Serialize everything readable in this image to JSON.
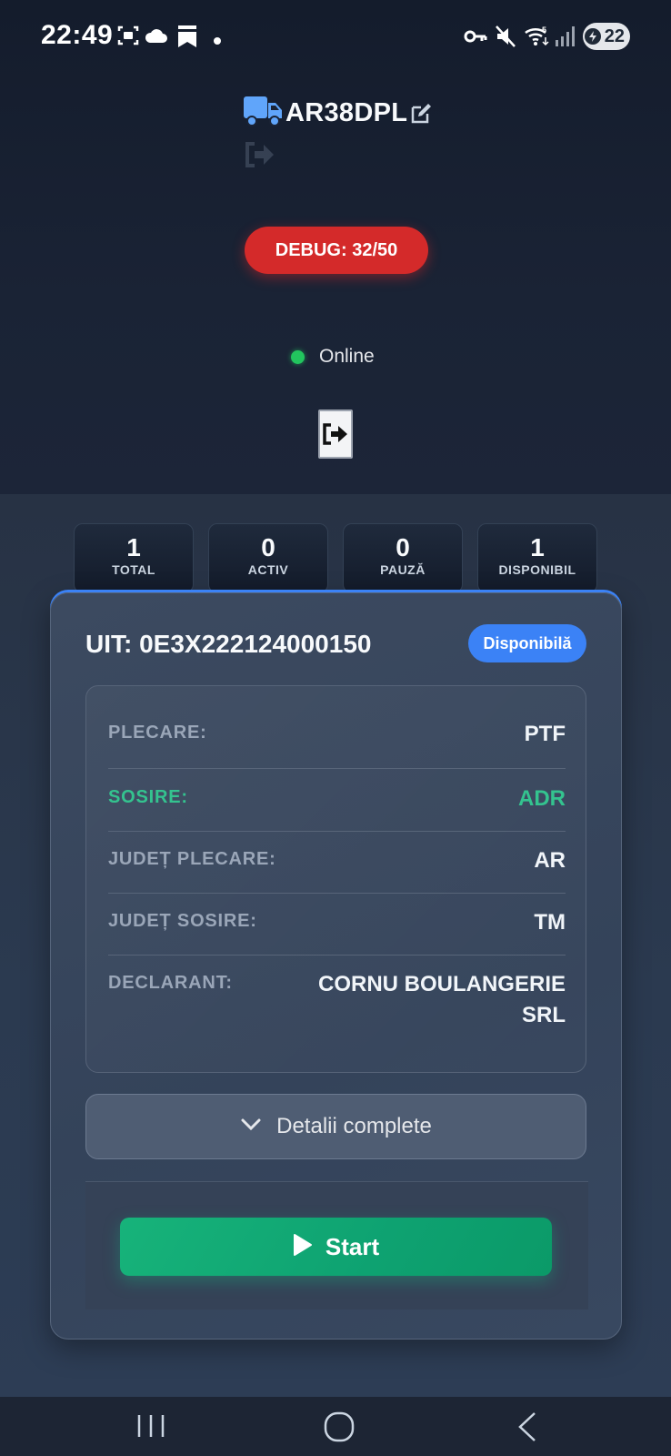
{
  "status_bar": {
    "time": "22:49",
    "battery_level": "22",
    "icons": [
      "screenshot-icon",
      "cloud-icon",
      "bookmark-icon",
      "dot-icon",
      "key-icon",
      "mute-icon",
      "wifi-icon",
      "signal-icon",
      "battery-icon"
    ]
  },
  "header": {
    "vehicle_plate": "AR38DPL",
    "debug_label": "DEBUG: 32/50",
    "connection_status": "Online"
  },
  "stats": [
    {
      "value": "1",
      "label": "TOTAL"
    },
    {
      "value": "0",
      "label": "ACTIV"
    },
    {
      "value": "0",
      "label": "PAUZĂ"
    },
    {
      "value": "1",
      "label": "DISPONIBIL"
    }
  ],
  "course": {
    "uit_title": "UIT: 0E3X222124000150",
    "status_badge": "Disponibilă",
    "fields": [
      {
        "label": "PLECARE:",
        "value": "PTF"
      },
      {
        "label": "SOSIRE:",
        "value": "ADR"
      },
      {
        "label": "JUDEȚ PLECARE:",
        "value": "AR"
      },
      {
        "label": "JUDEȚ SOSIRE:",
        "value": "TM"
      },
      {
        "label": "DECLARANT:",
        "value_line1": "CORNU BOULANGERIE",
        "value_line2": "SRL"
      }
    ],
    "details_toggle": "Detalii complete",
    "start_label": "Start"
  },
  "colors": {
    "accent_blue": "#3b82f6",
    "debug_red": "#d42a2a",
    "online_green": "#22c55e",
    "start_green": "#10b981",
    "highlight_green": "#34c38f"
  }
}
